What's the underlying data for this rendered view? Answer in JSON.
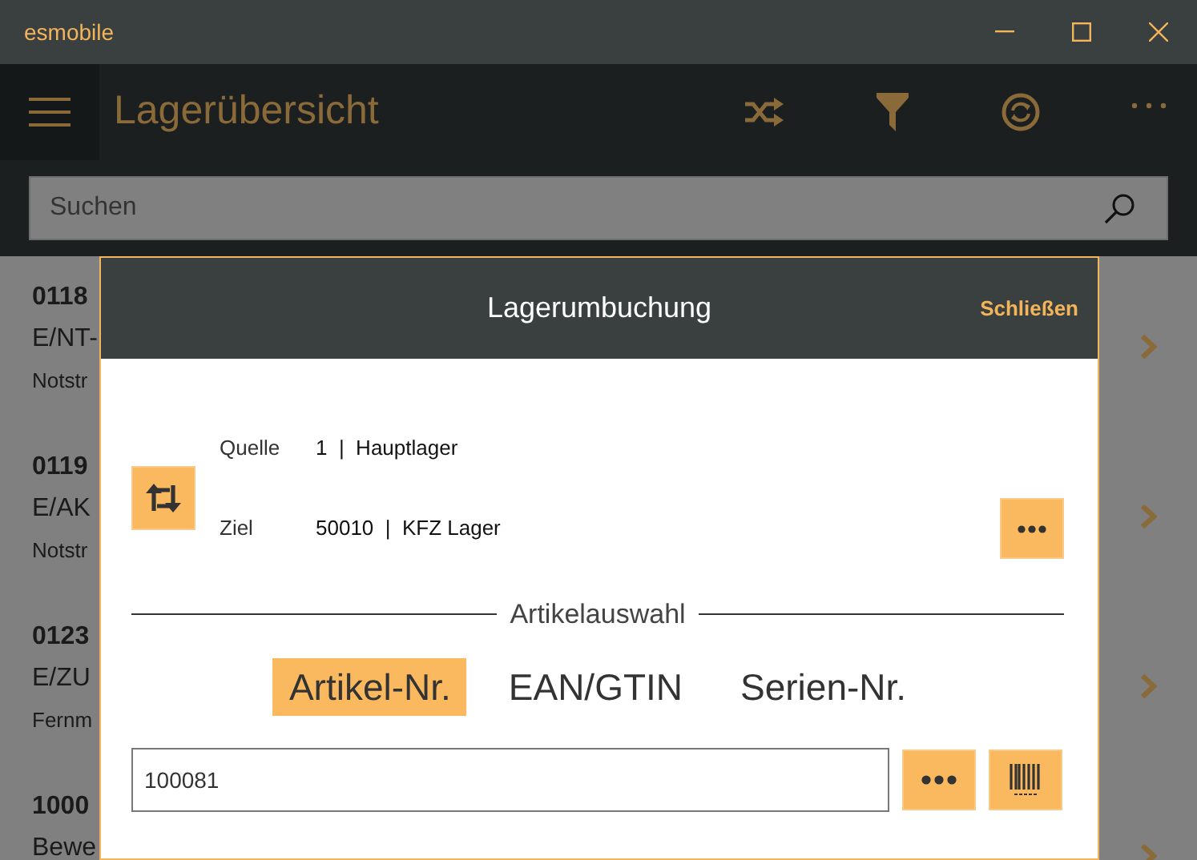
{
  "window": {
    "title": "esmobile"
  },
  "app_bar": {
    "title": "Lagerübersicht"
  },
  "search": {
    "placeholder": "Suchen"
  },
  "list_items": [
    {
      "number": "0118",
      "line_2": "E/NT-",
      "line_3": "Notstr"
    },
    {
      "number": "0119",
      "line_2": "E/AK",
      "line_3": "Notstr"
    },
    {
      "number": "0123",
      "line_2": "E/ZU",
      "line_3": "Fernm"
    },
    {
      "number": "1000",
      "line_2": "Bewe"
    }
  ],
  "dialog": {
    "title": "Lagerumbuchung",
    "close_label": "Schließen",
    "source": {
      "label": "Quelle",
      "value": "1  |  Hauptlager"
    },
    "target": {
      "label": "Ziel",
      "value": "50010  |  KFZ Lager"
    },
    "section_title": "Artikelauswahl",
    "modes": [
      {
        "label": "Artikel-Nr.",
        "selected": true
      },
      {
        "label": "EAN/GTIN",
        "selected": false
      },
      {
        "label": "Serien-Nr.",
        "selected": false
      }
    ],
    "article_input": {
      "value": "100081"
    }
  }
}
